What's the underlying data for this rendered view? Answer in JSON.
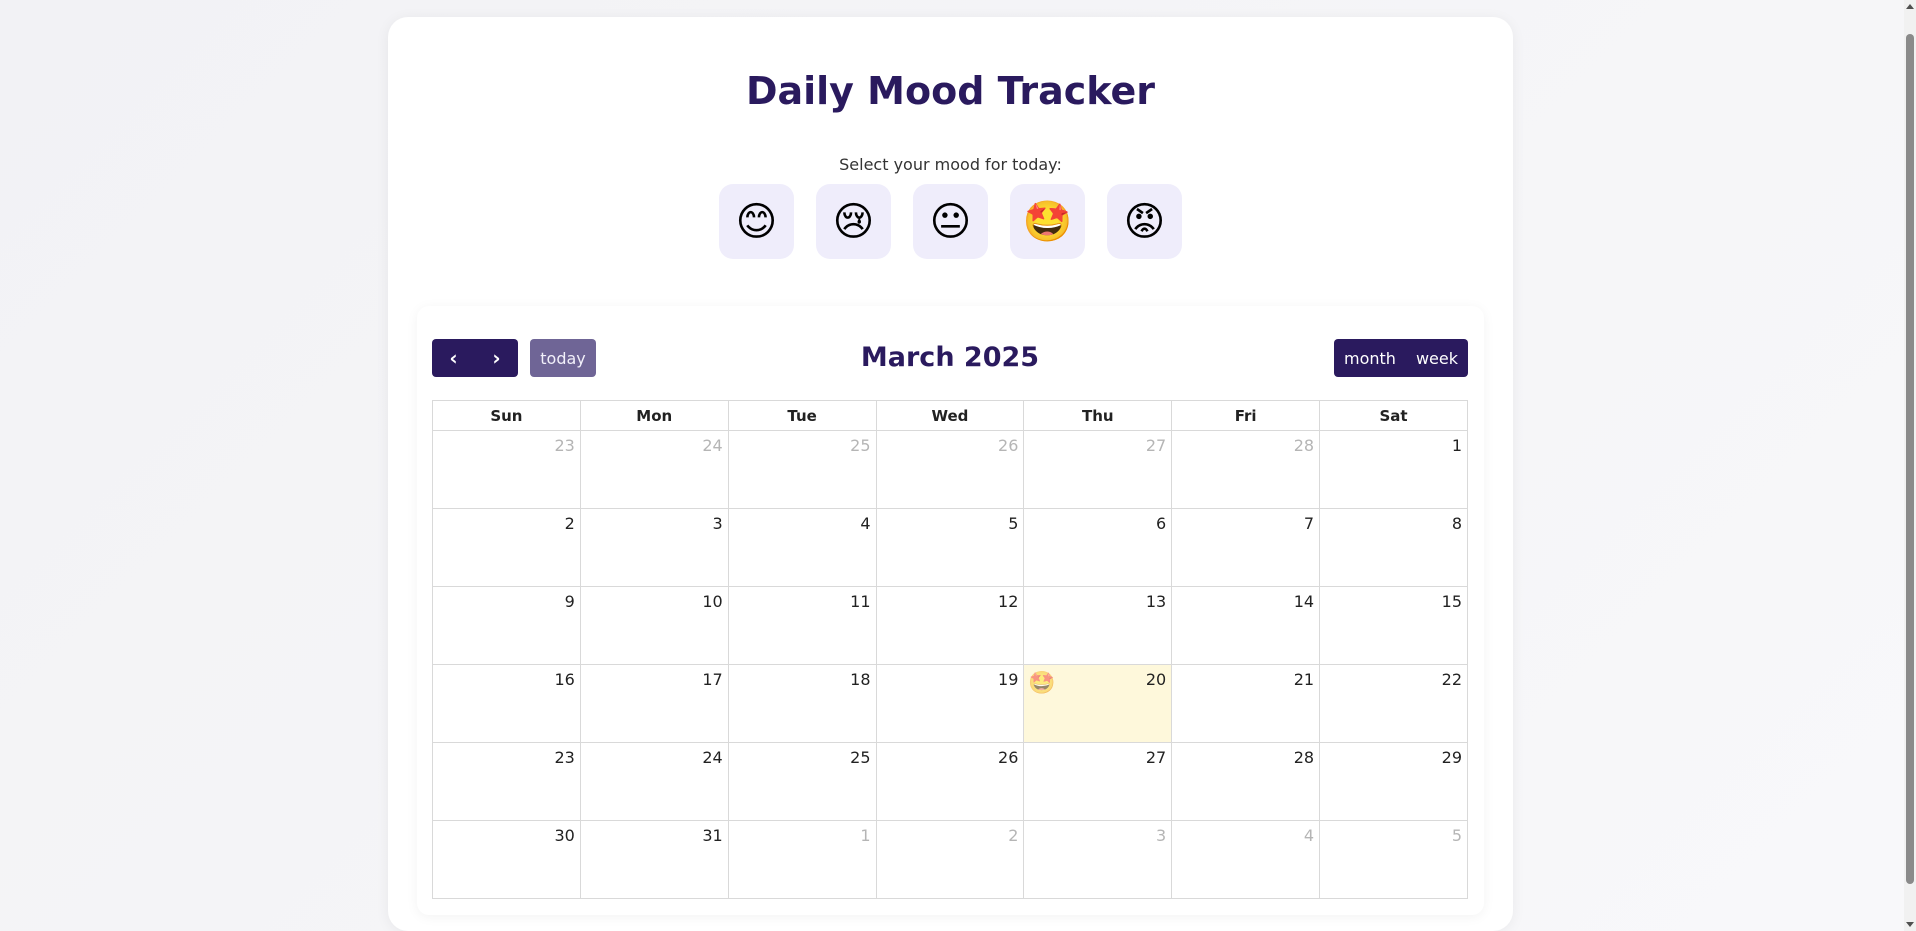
{
  "app": {
    "title": "Daily Mood Tracker",
    "prompt": "Select your mood for today:"
  },
  "moods": [
    {
      "emoji": "😊",
      "name": "happy"
    },
    {
      "emoji": "😢",
      "name": "sad"
    },
    {
      "emoji": "😐",
      "name": "neutral"
    },
    {
      "emoji": "🤩",
      "name": "excited"
    },
    {
      "emoji": "😡",
      "name": "angry"
    }
  ],
  "calendar": {
    "title": "March 2025",
    "prev_icon": "‹",
    "next_icon": "›",
    "today_label": "today",
    "views": [
      "month",
      "week"
    ],
    "weekdays": [
      "Sun",
      "Mon",
      "Tue",
      "Wed",
      "Thu",
      "Fri",
      "Sat"
    ],
    "weeks": [
      [
        {
          "d": "23",
          "other": true
        },
        {
          "d": "24",
          "other": true
        },
        {
          "d": "25",
          "other": true
        },
        {
          "d": "26",
          "other": true
        },
        {
          "d": "27",
          "other": true
        },
        {
          "d": "28",
          "other": true
        },
        {
          "d": "1"
        }
      ],
      [
        {
          "d": "2"
        },
        {
          "d": "3"
        },
        {
          "d": "4"
        },
        {
          "d": "5"
        },
        {
          "d": "6"
        },
        {
          "d": "7"
        },
        {
          "d": "8"
        }
      ],
      [
        {
          "d": "9"
        },
        {
          "d": "10"
        },
        {
          "d": "11"
        },
        {
          "d": "12"
        },
        {
          "d": "13"
        },
        {
          "d": "14"
        },
        {
          "d": "15"
        }
      ],
      [
        {
          "d": "16"
        },
        {
          "d": "17"
        },
        {
          "d": "18"
        },
        {
          "d": "19"
        },
        {
          "d": "20",
          "today": true,
          "mood": "🤩"
        },
        {
          "d": "21"
        },
        {
          "d": "22"
        }
      ],
      [
        {
          "d": "23"
        },
        {
          "d": "24"
        },
        {
          "d": "25"
        },
        {
          "d": "26"
        },
        {
          "d": "27"
        },
        {
          "d": "28"
        },
        {
          "d": "29"
        }
      ],
      [
        {
          "d": "30"
        },
        {
          "d": "31"
        },
        {
          "d": "1",
          "other": true
        },
        {
          "d": "2",
          "other": true
        },
        {
          "d": "3",
          "other": true
        },
        {
          "d": "4",
          "other": true
        },
        {
          "d": "5",
          "other": true
        }
      ]
    ]
  },
  "colors": {
    "primary": "#2a1a5e",
    "today_btn": "#6f6596",
    "mood_btn_bg": "#efedfb",
    "today_cell": "#fef8db"
  }
}
